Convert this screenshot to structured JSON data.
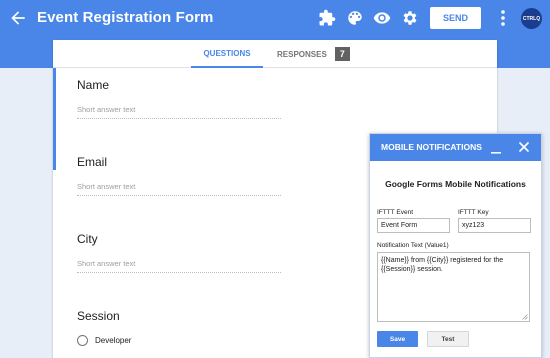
{
  "app": {
    "title": "Event Registration Form",
    "send_label": "SEND",
    "avatar_text": "CTRLQ",
    "bar_color": "#4a86e8",
    "toolbar_icons": [
      "addons-icon",
      "palette-icon",
      "preview-eye-icon",
      "settings-gear-icon",
      "more-vert-icon"
    ]
  },
  "tabs": {
    "questions": "QUESTIONS",
    "responses": "RESPONSES",
    "responses_count": "7"
  },
  "questions": [
    {
      "title": "Name",
      "placeholder": "Short answer text"
    },
    {
      "title": "Email",
      "placeholder": "Short answer text"
    },
    {
      "title": "City",
      "placeholder": "Short answer text"
    },
    {
      "title": "Session",
      "options": [
        "Developer"
      ]
    }
  ],
  "panel": {
    "title": "MOBILE NOTIFICATIONS",
    "heading": "Google Forms Mobile Notifications",
    "event_label": "IFTTT Event",
    "event_value": "Event Form",
    "key_label": "IFTTT Key",
    "key_value": "xyz123",
    "text_label": "Notification Text (Value1)",
    "text_value": "{{Name}} from {{City}} registered for the {{Session}} session.",
    "save_label": "Save",
    "test_label": "Test"
  }
}
